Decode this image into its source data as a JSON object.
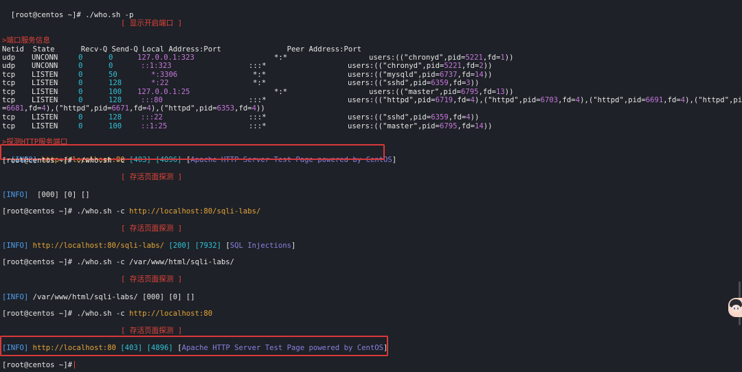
{
  "prompt": "[root@centos ~]#",
  "lines": {
    "l1_cmd": " ./who.sh -p",
    "port_banner": "[ 显示开启端口 ]",
    "port_info_title": ">端口服务信息",
    "header": "Netid  State      Recv-Q Send-Q Local Address:Port               Peer Address:Port",
    "rows": [
      {
        "netid": "udp",
        "state": "UNCONN",
        "recv": "0",
        "send": "0",
        "local": "127.0.0.1:323",
        "peer": "*:*",
        "users": "users:((\"chronyd\",pid=5221,fd=1))"
      },
      {
        "netid": "udp",
        "state": "UNCONN",
        "recv": "0",
        "send": "0",
        "local": "::1:323",
        "peer": ":::*",
        "users": "users:((\"chronyd\",pid=5221,fd=2))"
      },
      {
        "netid": "tcp",
        "state": "LISTEN",
        "recv": "0",
        "send": "50",
        "local": "*:3306",
        "peer": "*:*",
        "users": "users:((\"mysqld\",pid=6737,fd=14))"
      },
      {
        "netid": "tcp",
        "state": "LISTEN",
        "recv": "0",
        "send": "128",
        "local": "*:22",
        "peer": "*:*",
        "users": "users:((\"sshd\",pid=6359,fd=3))"
      },
      {
        "netid": "tcp",
        "state": "LISTEN",
        "recv": "0",
        "send": "100",
        "local": "127.0.0.1:25",
        "peer": "*:*",
        "users": "users:((\"master\",pid=6795,fd=13))"
      },
      {
        "netid": "tcp",
        "state": "LISTEN",
        "recv": "0",
        "send": "128",
        "local": ":::80",
        "peer": ":::*",
        "users": "users:((\"httpd\",pid=6719,fd=4),(\"httpd\",pid=6703,fd=4),(\"httpd\",pid=6691,fd=4),(\"httpd\",pid"
      },
      {
        "netid": "tcp",
        "state": "LISTEN",
        "recv": "0",
        "send": "128",
        "local": ":::22",
        "peer": ":::*",
        "users": "users:((\"sshd\",pid=6359,fd=4))"
      },
      {
        "netid": "tcp",
        "state": "LISTEN",
        "recv": "0",
        "send": "100",
        "local": "::1:25",
        "peer": ":::*",
        "users": "users:((\"master\",pid=6795,fd=14))"
      }
    ],
    "wrap_line": "=6681,fd=4),(\"httpd\",pid=6671,fd=4),(\"httpd\",pid=6353,fd=4))",
    "http_probe_title": ">探测HTTP服务端口",
    "result1": {
      "tag": "[INFO]",
      "url": "http://localhost:80",
      "code": "[403]",
      "size": "[4896]",
      "title": "Apache HTTP Server Test Page powered by CentOS"
    },
    "cmd2": " ./who.sh -c",
    "alive_banner": "[ 存活页面探测 ]",
    "result2": {
      "tag": "[INFO]",
      "rest": "  [000] [0] []"
    },
    "cmd3": " ./who.sh -c ",
    "cmd3_url": "http://localhost:80/sqli-labs/",
    "result3": {
      "tag": "[INFO]",
      "url": "http://localhost:80/sqli-labs/",
      "code": "[200]",
      "size": "[7932]",
      "title": "SQL Injections"
    },
    "cmd4": " ./who.sh -c /var/www/html/sqli-labs/",
    "result4": {
      "tag": "[INFO]",
      "rest": " /var/www/html/sqli-labs/ [000] [0] []"
    },
    "cmd5": " ./who.sh -c ",
    "cmd5_url": "http://localhost:80",
    "result5": {
      "tag": "[INFO]",
      "url": "http://localhost:80",
      "code": "[403]",
      "size": "[4896]",
      "title": "Apache HTTP Server Test Page powered by CentOS"
    }
  },
  "colors": {
    "background": "#1e2127",
    "highlight_box": "#d9383a",
    "prompt": "#e6e6e6",
    "banner": "#e0443b"
  }
}
